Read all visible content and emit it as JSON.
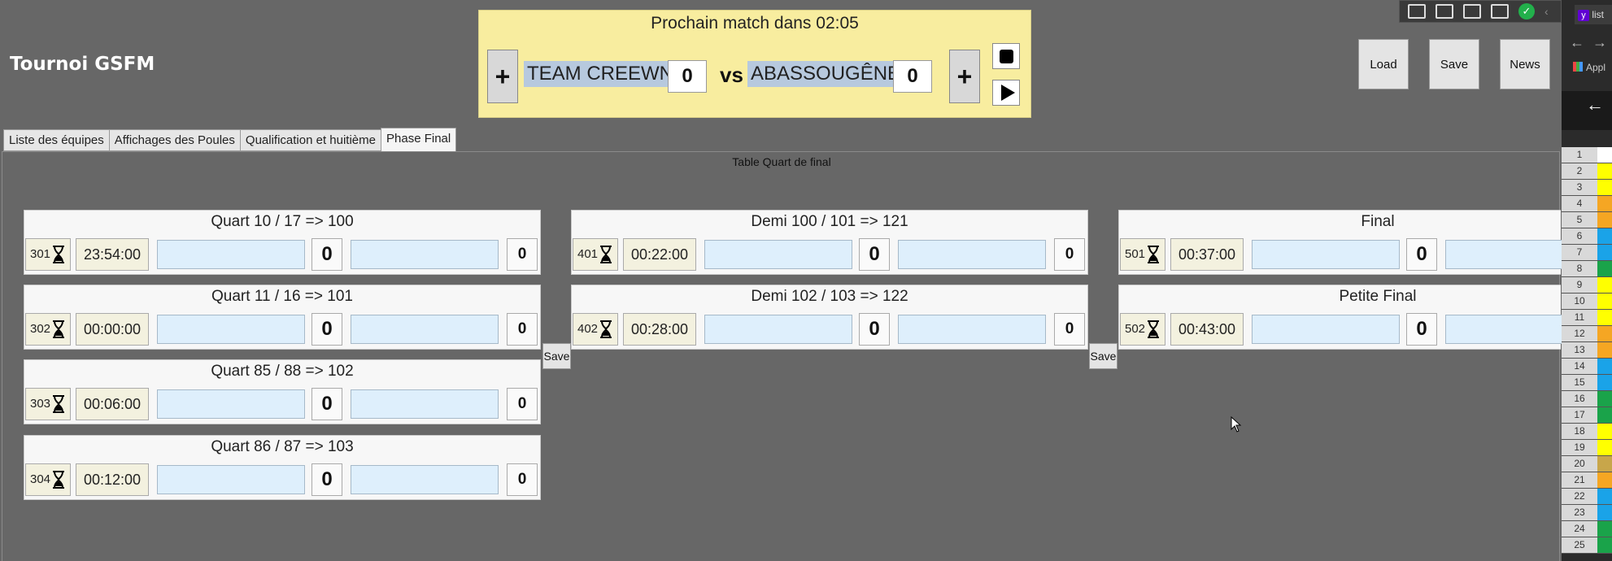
{
  "app": {
    "title": "Tournoi GSFM"
  },
  "banner": {
    "title": "Prochain match dans 02:05",
    "team1": "TEAM CREEWN",
    "team2": "ABASSOUGÊNE",
    "score1": "0",
    "score2": "0",
    "vs": "vs",
    "plus": "+"
  },
  "actions": {
    "load": "Load",
    "save": "Save",
    "news": "News"
  },
  "tabs": [
    {
      "label": "Liste des équipes"
    },
    {
      "label": "Affichages des Poules"
    },
    {
      "label": "Qualification  et huitième"
    },
    {
      "label": "Phase Final"
    }
  ],
  "content": {
    "caption": "Table Quart de final",
    "save_label": "Save",
    "quarters": [
      {
        "title": "Quart 10 / 17 => 100",
        "id": "301",
        "time": "23:54:00",
        "score1": "0",
        "score2": "0"
      },
      {
        "title": "Quart 11  / 16  => 101",
        "id": "302",
        "time": "00:00:00",
        "score1": "0",
        "score2": "0"
      },
      {
        "title": "Quart 85 / 88  => 102",
        "id": "303",
        "time": "00:06:00",
        "score1": "0",
        "score2": "0"
      },
      {
        "title": "Quart 86 / 87  => 103",
        "id": "304",
        "time": "00:12:00",
        "score1": "0",
        "score2": "0"
      }
    ],
    "semis": [
      {
        "title": "Demi 100 / 101 => 121",
        "id": "401",
        "time": "00:22:00",
        "score1": "0",
        "score2": "0"
      },
      {
        "title": "Demi 102 / 103 => 122",
        "id": "402",
        "time": "00:28:00",
        "score1": "0",
        "score2": "0"
      }
    ],
    "finals": [
      {
        "title": "Final",
        "id": "501",
        "time": "00:37:00",
        "score1": "0"
      },
      {
        "title": "Petite Final",
        "id": "502",
        "time": "00:43:00",
        "score1": "0"
      }
    ]
  },
  "excel": {
    "tab_label": "list",
    "apps_label": "Appl",
    "rows": [
      "1",
      "2",
      "3",
      "4",
      "5",
      "6",
      "7",
      "8",
      "9",
      "10",
      "11",
      "12",
      "13",
      "14",
      "15",
      "16",
      "17",
      "18",
      "19",
      "20",
      "21",
      "22",
      "23",
      "24",
      "25"
    ],
    "row_colors": [
      "#ffffff",
      "#ffff00",
      "#ffff00",
      "#f5a623",
      "#f5a623",
      "#1aa3e8",
      "#1aa3e8",
      "#1aa34a",
      "#ffff00",
      "#ffff00",
      "#ffff00",
      "#f5a623",
      "#f5a623",
      "#1aa3e8",
      "#1aa3e8",
      "#1aa34a",
      "#1aa34a",
      "#ffff00",
      "#ffff00",
      "#c8a64a",
      "#f5a623",
      "#1aa3e8",
      "#1aa3e8",
      "#1aa34a",
      "#1aa34a"
    ]
  }
}
